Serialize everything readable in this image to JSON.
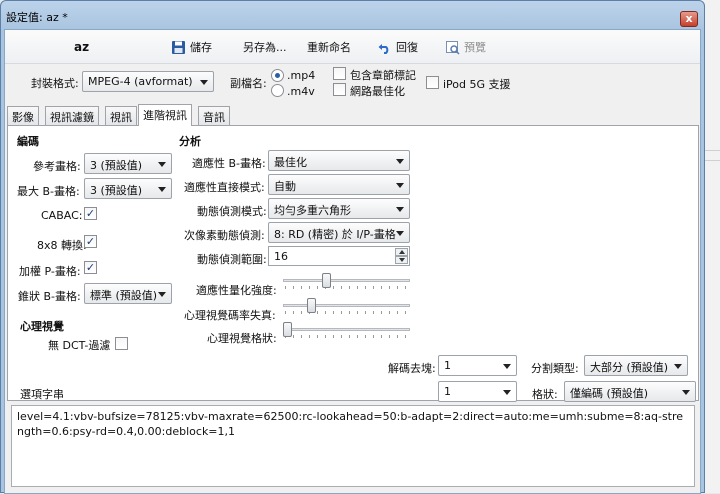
{
  "window": {
    "title": "設定值: az *",
    "close_glyph": "x"
  },
  "toolbar": {
    "name": "az",
    "save": "儲存",
    "save_as": "另存為...",
    "rename": "重新命名",
    "revert": "回復",
    "preview": "預覽"
  },
  "general": {
    "container_label": "封裝格式:",
    "container_value": "MPEG-4 (avformat)",
    "ext_label": "副檔名:",
    "ext_mp4": ".mp4",
    "ext_m4v": ".m4v",
    "chapter_markers": "包含章節標記",
    "web_optimized": "網路最佳化",
    "ipod": "iPod 5G 支援"
  },
  "tabs": [
    "影像",
    "視訊濾鏡",
    "視訊",
    "進階視訊",
    "音訊"
  ],
  "encoding": {
    "header": "編碼",
    "ref_frames_label": "參考畫格:",
    "ref_frames_value": "3 (預設值)",
    "max_b_label": "最大 B-畫格:",
    "max_b_value": "3 (預設值)",
    "cabac_label": "CABAC:",
    "t8x8_label": "8x8 轉換:",
    "weighted_p_label": "加權 P-畫格:",
    "pyramid_label": "錐狀 B-畫格:",
    "pyramid_value": "標準 (預設值)"
  },
  "psy": {
    "header": "心理視覺",
    "no_dct_label": "無 DCT-過濾"
  },
  "analysis": {
    "header": "分析",
    "adaptive_b_label": "適應性 B-畫格:",
    "adaptive_b_value": "最佳化",
    "direct_label": "適應性直接模式:",
    "direct_value": "自動",
    "me_label": "動態偵測模式:",
    "me_value": "均勻多重六角形",
    "subme_label": "次像素動態偵測:",
    "subme_value": "8: RD (精密) 於 I/P-畫格",
    "merange_label": "動態偵測範圍:",
    "merange_value": "16",
    "aq_label": "適應性量化強度:",
    "psy_rd_label": "心理視覺碼率失真:",
    "psy_trellis_label": "心理視覺格狀:",
    "aq_level": 0.33,
    "psy_rd_level": 0.2,
    "psy_trellis_level": 0.0
  },
  "deblock": {
    "label": "解碼去塊:",
    "value1": "1",
    "value2": "1",
    "partition_label": "分割類型:",
    "partition_value": "大部分 (預設值)",
    "trellis_label": "格狀:",
    "trellis_value": "僅編碼 (預設值)"
  },
  "options": {
    "label": "選項字串",
    "text": "level=4.1:vbv-bufsize=78125:vbv-maxrate=62500:rc-lookahead=50:b-adapt=2:direct=auto:me=umh:subme=8:aq-strength=0.6:psy-rd=0.4,0.00:deblock=1,1"
  },
  "checkmark": "✓"
}
